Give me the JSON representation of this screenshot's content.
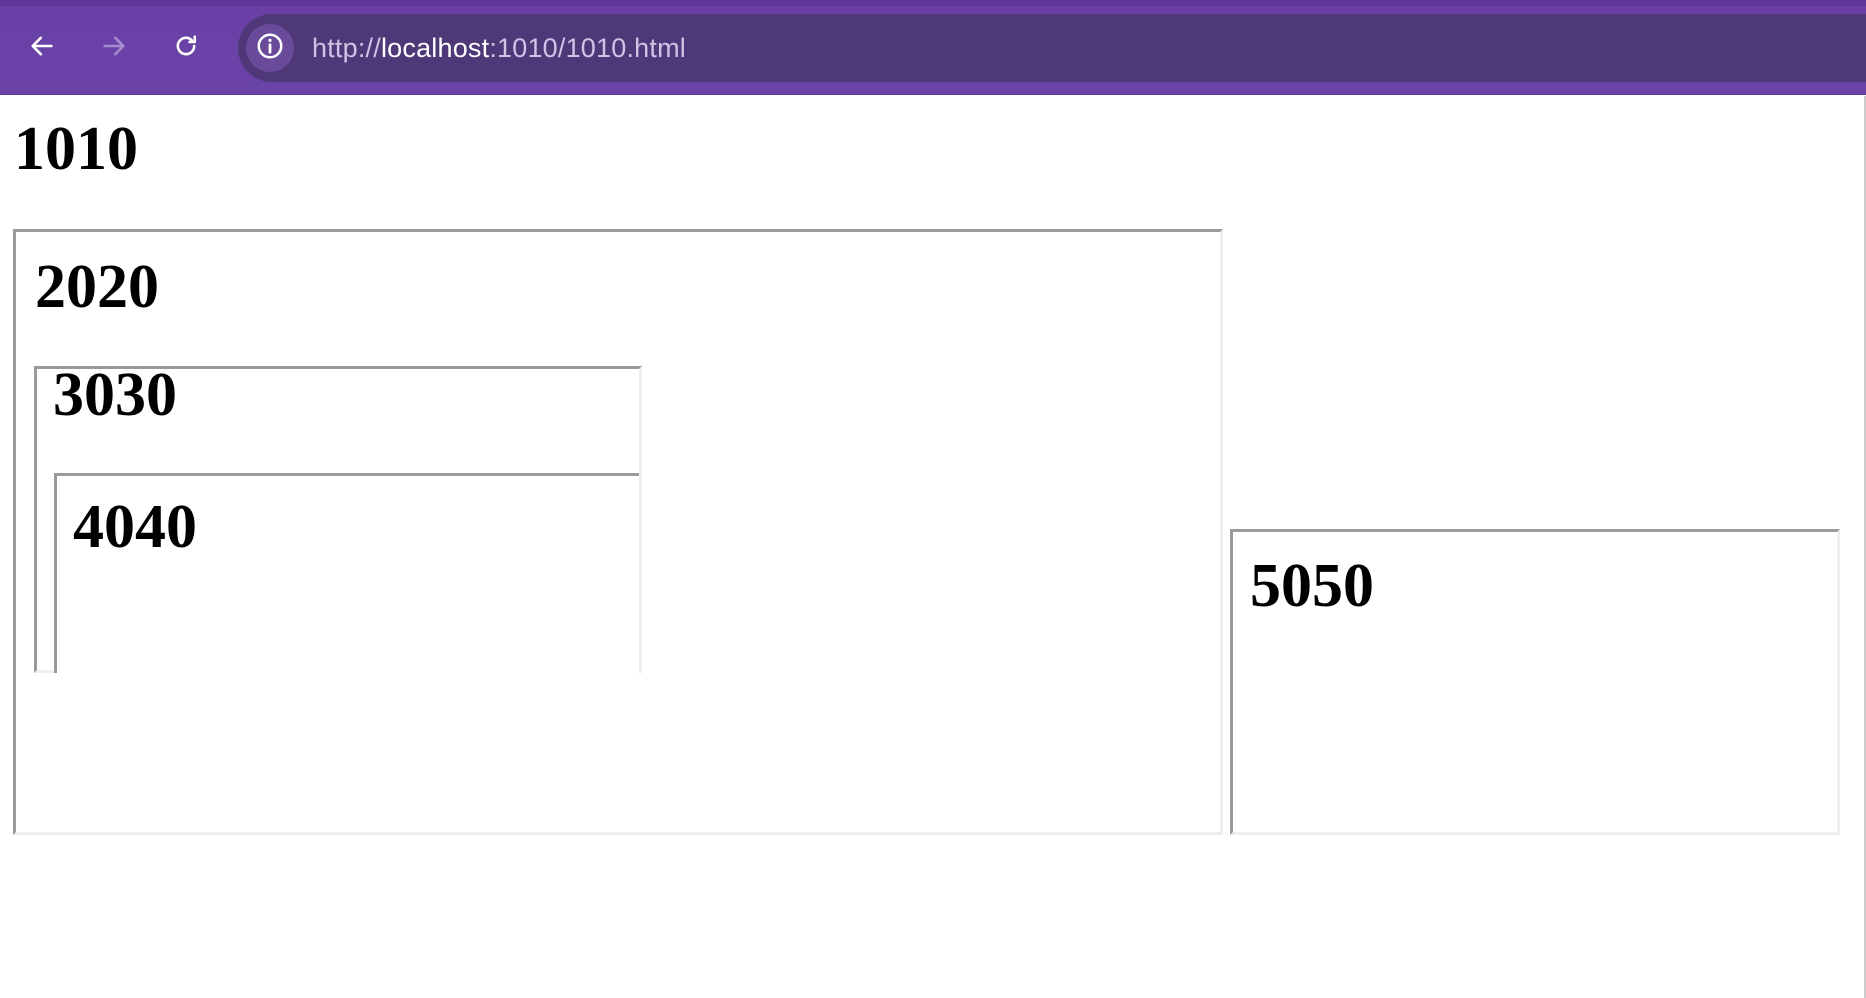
{
  "browser": {
    "url_scheme": "http://",
    "url_host": "localhost",
    "url_path": ":1010/1010.html",
    "icons": {
      "back": "arrow-left-icon",
      "forward": "arrow-right-icon",
      "reload": "reload-icon",
      "site_info": "info-icon"
    },
    "colors": {
      "toolbar": "#6b44a8",
      "omnibox": "#4e3878",
      "url_text": "#cfc3e6",
      "url_host": "#ffffff"
    }
  },
  "page": {
    "heading_1010": "1010",
    "box_2020": {
      "heading": "2020"
    },
    "box_3030": {
      "heading": "3030"
    },
    "box_4040": {
      "heading": "4040"
    },
    "box_5050": {
      "heading": "5050"
    }
  }
}
